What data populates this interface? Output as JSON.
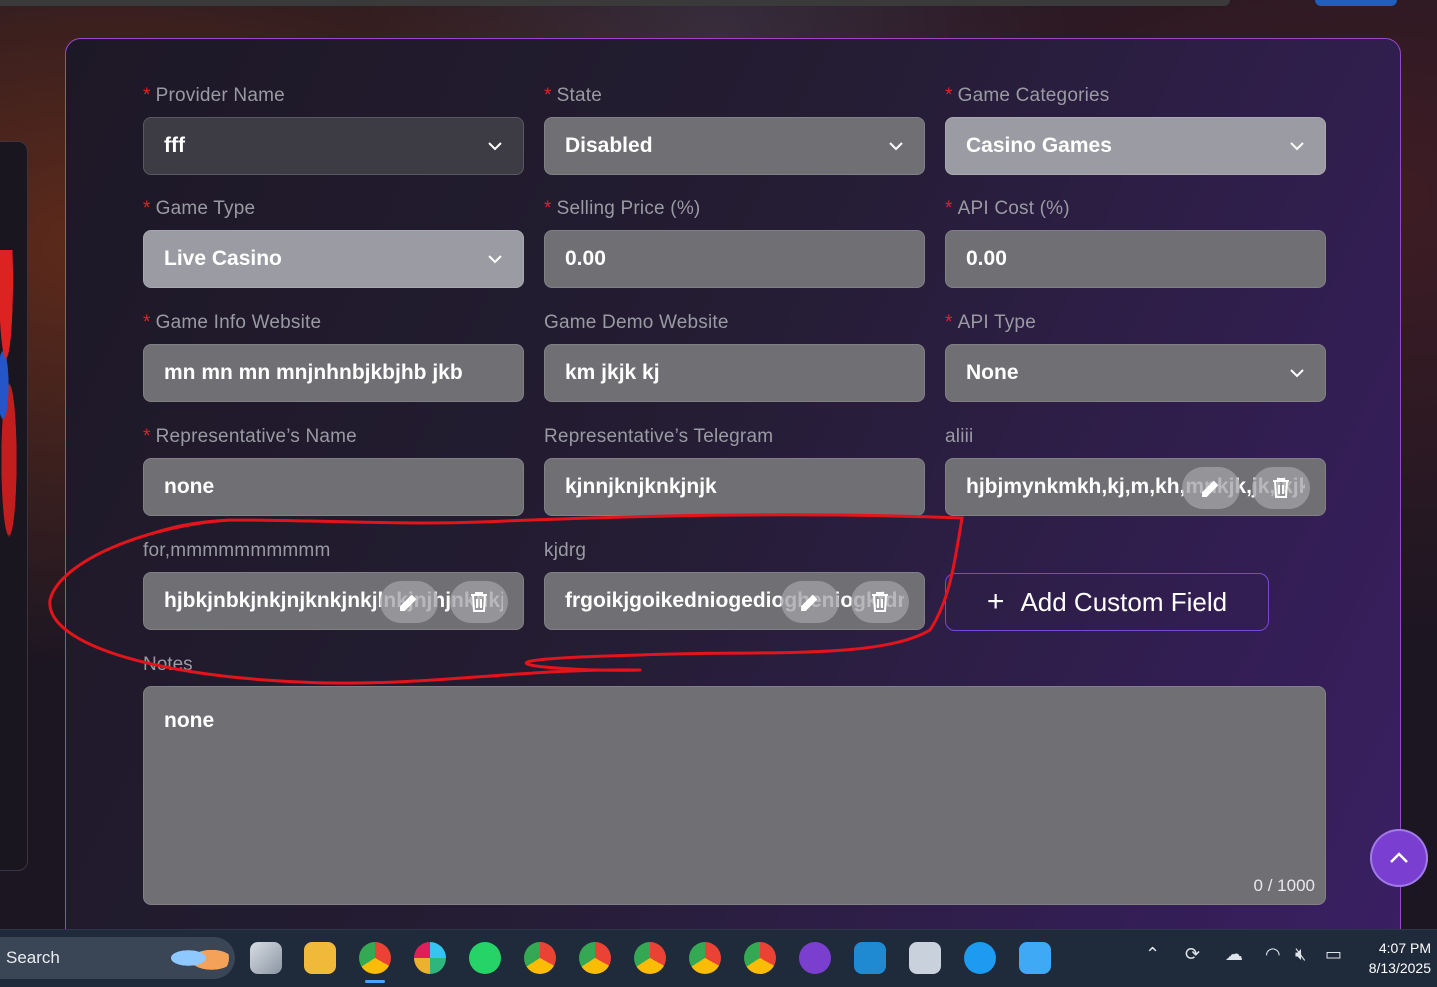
{
  "form": {
    "provider_name": {
      "label": "Provider Name",
      "value": "fff"
    },
    "state": {
      "label": "State",
      "value": "Disabled"
    },
    "game_categories": {
      "label": "Game Categories",
      "value": "Casino Games"
    },
    "game_type": {
      "label": "Game Type",
      "value": "Live Casino"
    },
    "selling_price": {
      "label": "Selling Price (%)",
      "value": "0.00"
    },
    "api_cost": {
      "label": "API Cost (%)",
      "value": "0.00"
    },
    "game_info_website": {
      "label": "Game Info Website",
      "value": "mn mn mn mnjnhnbjkbjhb jkb"
    },
    "game_demo_website": {
      "label": "Game Demo Website",
      "value": "km jkjk kj"
    },
    "api_type": {
      "label": "API Type",
      "value": "None"
    },
    "rep_name": {
      "label": "Representative’s Name",
      "value": "none"
    },
    "rep_telegram": {
      "label": "Representative’s Telegram",
      "value": "kjnnjknjknkjnjk"
    },
    "custom_fields": [
      {
        "label": "aliii",
        "value": "hjbjmynkmkh,kj,m,kh,mnkjk,jk,jkjkjk"
      },
      {
        "label": "for,mmmmmmmmmm",
        "value": "hjbkjnbkjnkjnjknkjnkjlnkjnjhjnknkjn"
      },
      {
        "label": "kjdrg",
        "value": "frgoikjgoikedniogediogheniogkfdn"
      }
    ],
    "add_custom_field": "Add Custom Field",
    "required_mark": "*",
    "notes": {
      "label": "Notes",
      "value": "none",
      "counter": "0 / 1000"
    }
  },
  "taskbar": {
    "search_label": "Search",
    "time": "4:07 PM",
    "date": "8/13/2025",
    "pinned": [
      "file-explorer",
      "chrome-w",
      "slack",
      "whatsapp",
      "chrome-wager",
      "chrome",
      "chrome",
      "chrome",
      "chrome",
      "github-desktop",
      "vscode",
      "snipping-tool",
      "docker",
      "notepad"
    ]
  },
  "colors": {
    "accent": "#7b46d8",
    "required": "#e02424",
    "panel_border": "#9a46c8",
    "annotation": "#e3141b"
  }
}
